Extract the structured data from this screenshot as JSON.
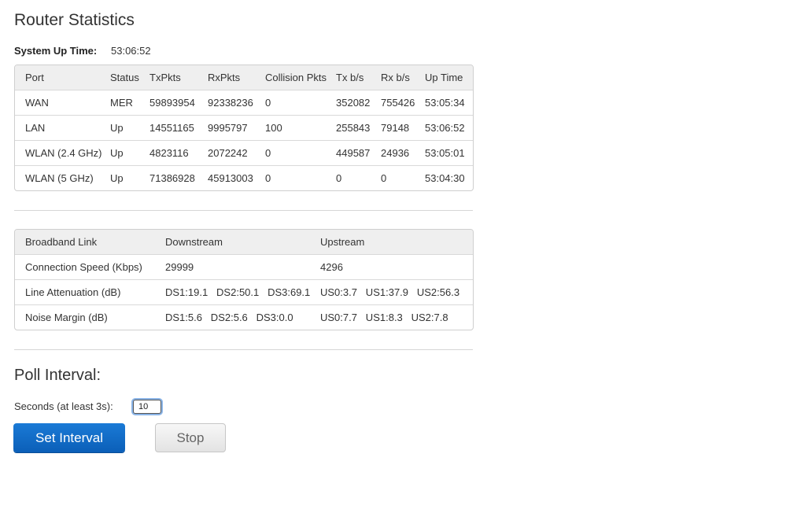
{
  "page": {
    "title": "Router Statistics",
    "uptime_label": "System Up Time:",
    "uptime_value": "53:06:52"
  },
  "stats_table": {
    "headers": [
      "Port",
      "Status",
      "TxPkts",
      "RxPkts",
      "Collision Pkts",
      "Tx b/s",
      "Rx b/s",
      "Up Time"
    ],
    "rows": [
      [
        "WAN",
        "MER",
        "59893954",
        "92338236",
        "0",
        "352082",
        "755426",
        "53:05:34"
      ],
      [
        "LAN",
        "Up",
        "14551165",
        "9995797",
        "100",
        "255843",
        "79148",
        "53:06:52"
      ],
      [
        "WLAN (2.4 GHz)",
        "Up",
        "4823116",
        "2072242",
        "0",
        "449587",
        "24936",
        "53:05:01"
      ],
      [
        "WLAN (5 GHz)",
        "Up",
        "71386928",
        "45913003",
        "0",
        "0",
        "0",
        "53:04:30"
      ]
    ]
  },
  "broadband_table": {
    "headers": [
      "Broadband Link",
      "Downstream",
      "Upstream"
    ],
    "rows": [
      [
        "Connection Speed (Kbps)",
        "29999",
        "4296"
      ],
      [
        "Line Attenuation (dB)",
        "DS1:19.1   DS2:50.1   DS3:69.1",
        "US0:3.7   US1:37.9   US2:56.3"
      ],
      [
        "Noise Margin (dB)",
        "DS1:5.6   DS2:5.6   DS3:0.0",
        "US0:7.7   US1:8.3   US2:7.8"
      ]
    ]
  },
  "poll": {
    "title": "Poll Interval:",
    "seconds_label": "Seconds (at least 3s):",
    "seconds_value": "10",
    "set_label": "Set Interval",
    "stop_label": "Stop"
  }
}
